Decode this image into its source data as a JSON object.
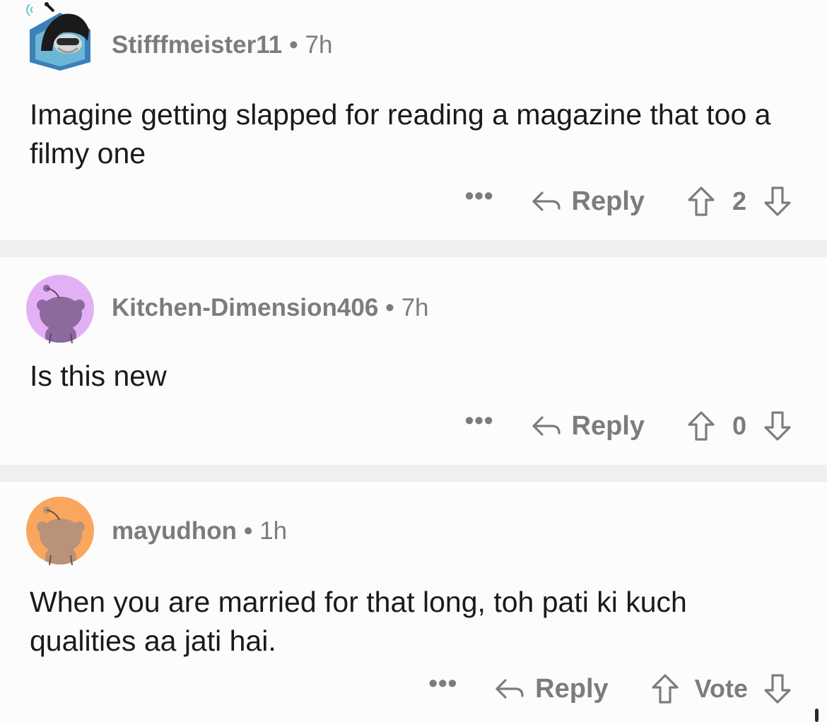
{
  "comments": [
    {
      "username": "Stifffmeister11",
      "separator": "•",
      "age": "7h",
      "body": "Imagine getting slapped for reading a magazine that too a filmy one",
      "more": "•••",
      "reply_label": "Reply",
      "vote_label": "2",
      "avatar": "hooded-snoo-avatar-icon"
    },
    {
      "username": "Kitchen-Dimension406",
      "separator": "•",
      "age": "7h",
      "body": "Is this new",
      "more": "•••",
      "reply_label": "Reply",
      "vote_label": "0",
      "avatar": "default-snoo-avatar-icon",
      "avatar_bg": "#e4b0f5"
    },
    {
      "username": "mayudhon",
      "separator": "•",
      "age": "1h",
      "body": "When you are married for that long, toh pati ki kuch qualities aa jati hai.",
      "more": "•••",
      "reply_label": "Reply",
      "vote_label": "Vote",
      "avatar": "default-snoo-avatar-icon",
      "avatar_bg": "#fba65d"
    }
  ],
  "colors": {
    "text": "#1a1a1b",
    "muted": "#7c7c7c",
    "background": "#fcfcfd",
    "divider": "#efeff1"
  }
}
